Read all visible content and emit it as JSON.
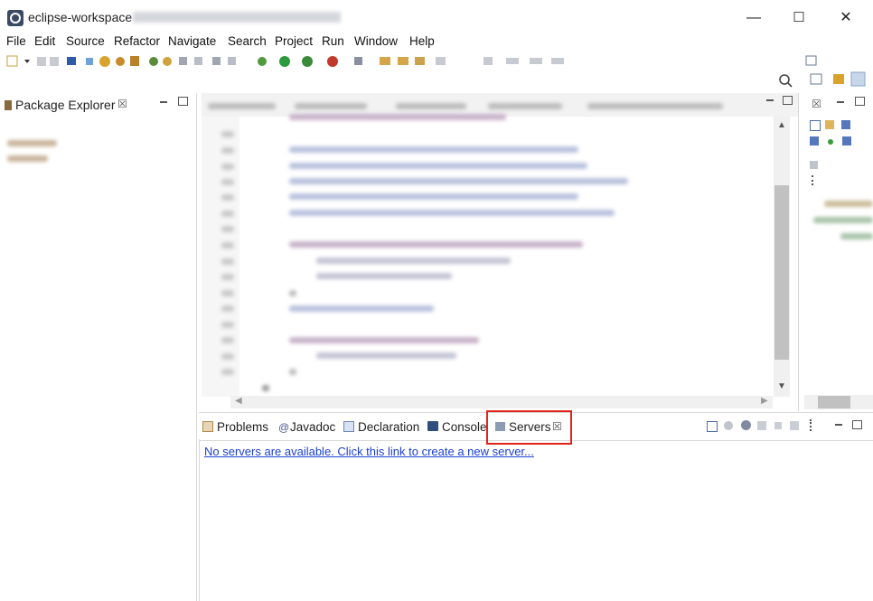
{
  "window": {
    "title": "eclipse-workspace -",
    "minimize_glyph": "—",
    "maximize_glyph": "☐",
    "close_glyph": "✕"
  },
  "menubar": {
    "items": [
      "File",
      "Edit",
      "Source",
      "Refactor",
      "Navigate",
      "Search",
      "Project",
      "Run",
      "Window",
      "Help"
    ]
  },
  "package_explorer": {
    "title": "Package Explorer",
    "close_glyph": "☒"
  },
  "bottom_view": {
    "tabs": [
      {
        "label": "Problems",
        "icon": "problems-icon"
      },
      {
        "label": "Javadoc",
        "icon": "at-icon",
        "glyph": "@"
      },
      {
        "label": "Declaration",
        "icon": "declaration-icon"
      },
      {
        "label": "Console",
        "icon": "console-icon"
      },
      {
        "label": "Servers",
        "icon": "servers-icon",
        "active": true
      }
    ],
    "close_glyph": "☒",
    "servers_message": "No servers are available. Click this link to create a new server..."
  },
  "colors": {
    "highlight": "#e0241b",
    "link": "#1a3fd1"
  }
}
